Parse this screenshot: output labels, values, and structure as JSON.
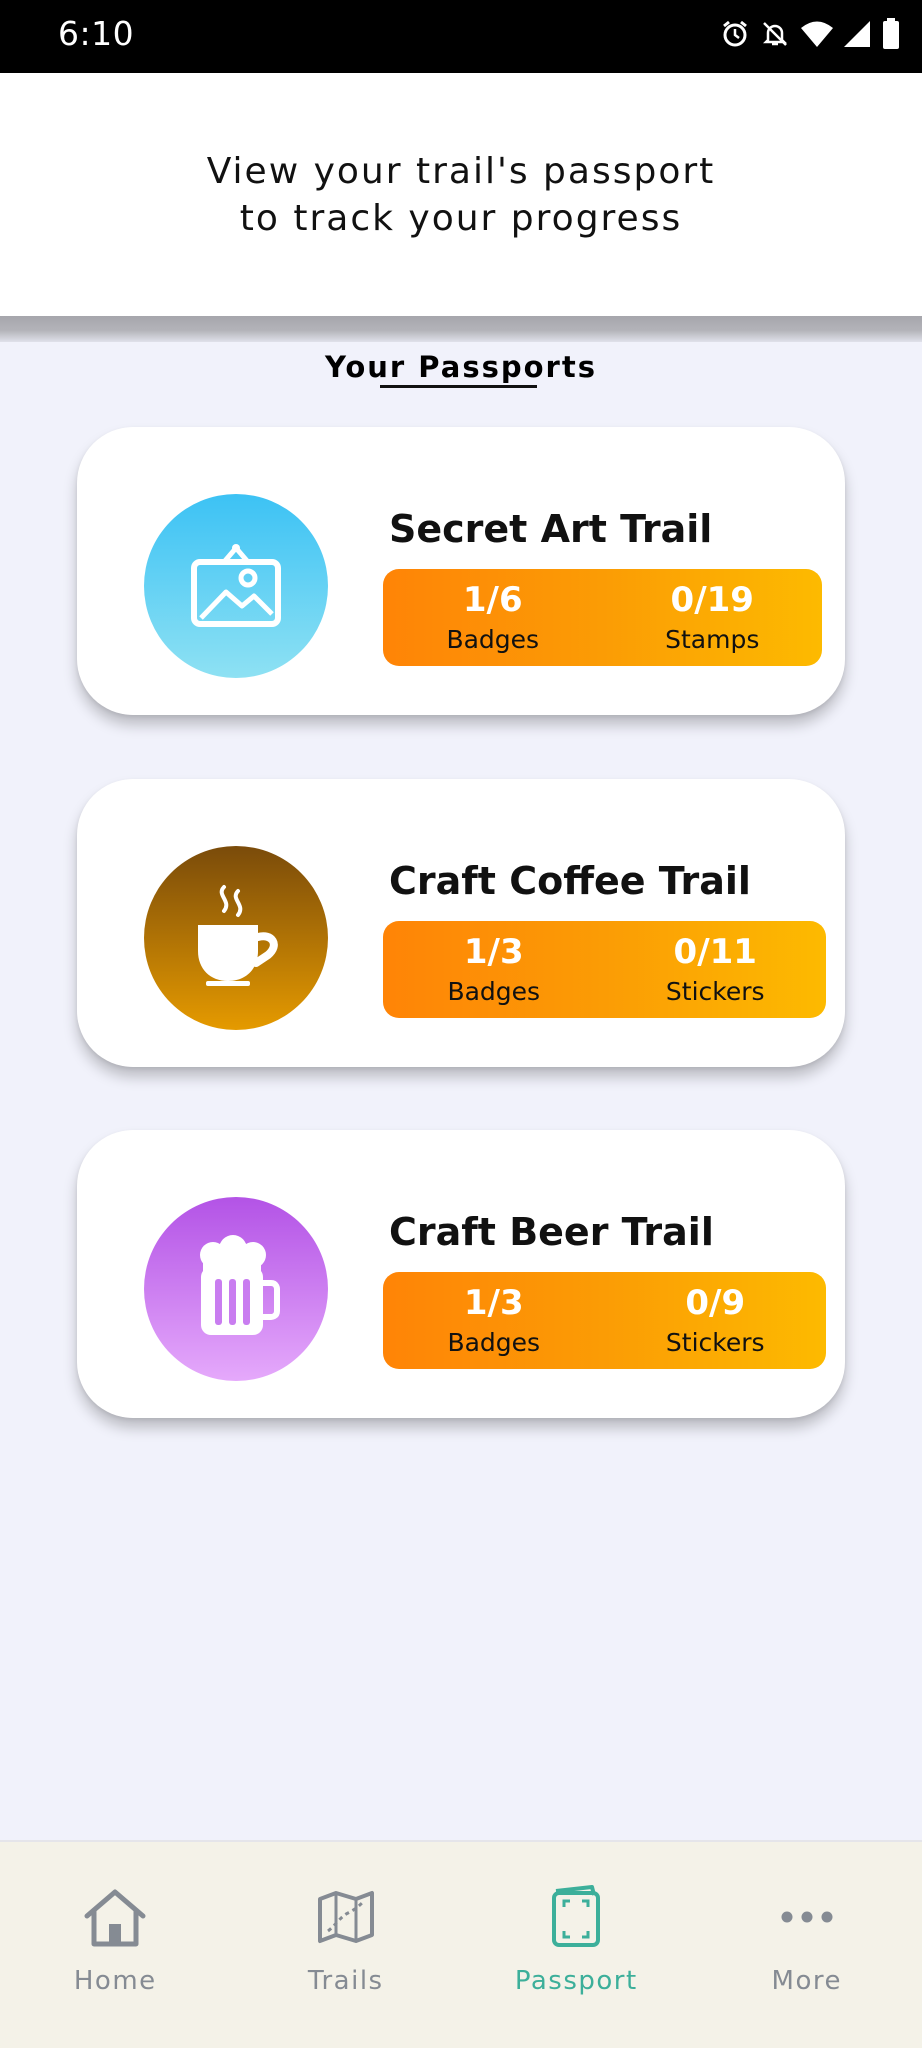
{
  "status_bar": {
    "time": "6:10",
    "icons": [
      "alarm-icon",
      "notifications-off-icon",
      "wifi-icon",
      "signal-icon",
      "battery-icon"
    ]
  },
  "header": {
    "line1": "View your trail's passport",
    "line2": "to track your progress"
  },
  "section": {
    "title": "Your Passports"
  },
  "passports": [
    {
      "title": "Secret Art Trail",
      "icon": "framed-picture-icon",
      "badges_value": "1/6",
      "badges_label": "Badges",
      "collect_value": "0/19",
      "collect_label": "Stamps"
    },
    {
      "title": "Craft Coffee Trail",
      "icon": "coffee-cup-icon",
      "badges_value": "1/3",
      "badges_label": "Badges",
      "collect_value": "0/11",
      "collect_label": "Stickers"
    },
    {
      "title": "Craft Beer Trail",
      "icon": "beer-mug-icon",
      "badges_value": "1/3",
      "badges_label": "Badges",
      "collect_value": "0/9",
      "collect_label": "Stickers"
    }
  ],
  "nav": {
    "items": [
      {
        "label": "Home",
        "icon": "home-icon"
      },
      {
        "label": "Trails",
        "icon": "map-icon"
      },
      {
        "label": "Passport",
        "icon": "passport-icon"
      },
      {
        "label": "More",
        "icon": "more-dots-icon"
      }
    ],
    "active": "Passport"
  },
  "colors": {
    "accent": "#3caf9a",
    "stats_gradient_start": "#ff8406",
    "stats_gradient_end": "#fdba00",
    "background": "#f1f2fb"
  }
}
